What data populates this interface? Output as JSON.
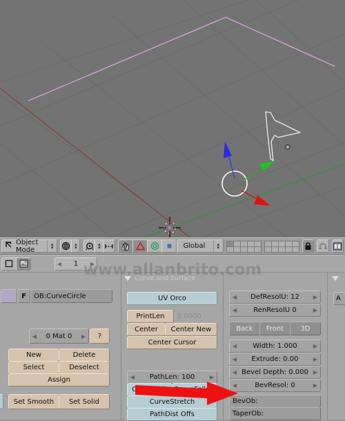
{
  "viewport": {
    "name": "3d-viewport",
    "background_color": "#737373",
    "grid_color": "#6a6a6a",
    "axis_x_color": "#8c3a3a",
    "axis_y_color": "#3a8c3a",
    "objects": [
      {
        "name": "curve-path-pink",
        "color": "#d9a6d9",
        "type": "path-curve"
      },
      {
        "name": "curve-shape-white",
        "color": "#e8e0ec",
        "type": "bezier-curve"
      },
      {
        "name": "curve-circle",
        "color": "#ffffff",
        "type": "circle"
      }
    ],
    "manipulator": {
      "x_axis_color": "#e01010",
      "y_axis_color": "#10c010",
      "z_axis_color": "#2020e0"
    },
    "cursor_3d": "3d-cursor"
  },
  "header": {
    "mode": "Object Mode",
    "transform_orientation": "Global",
    "icons": {
      "mode_icon": "object-mode-icon",
      "shading_icon": "shading-solid-icon",
      "pivot_icon": "pivot-median-icon",
      "snap_icon": "snap-icon",
      "manip_hand": "manipulator-translate-icon",
      "manip_rotate": "manipulator-rotate-icon",
      "manip_scale": "manipulator-scale-icon",
      "manip_square": "manipulator-square-icon",
      "lock_icon": "lock-icon",
      "magnet_icon": "magnet-icon",
      "render_icon": "render-window-icon"
    },
    "layers_lock": "lock-icon"
  },
  "second_bar": {
    "icons": {
      "buttons_window_icon": "buttons-window-icon",
      "image_icon": "image-browser-icon"
    },
    "frame": "1"
  },
  "watermark": "www.allanbrito.com",
  "panels": {
    "link_and_materials": {
      "object_field": {
        "prefix": "F",
        "value": "OB:CurveCircle"
      },
      "material_index": "0 Mat 0",
      "help_button": "?",
      "buttons": [
        "New",
        "Delete",
        "Select",
        "Deselect",
        "Assign"
      ],
      "shading": [
        "Set Smooth",
        "Set Solid"
      ]
    },
    "curve_and_surface": {
      "title": "Curve and Surface",
      "uv_orco": "UV Orco",
      "printlen": "PrintLen",
      "printlen_value": "0.0000",
      "center": "Center",
      "center_new": "Center New",
      "center_cursor": "Center Cursor",
      "pathlen": "PathLen: 100",
      "curvepath": "CurvePath",
      "curvefollow": "CurveFollow",
      "curvestretch": "CurveStretch",
      "pathdist_offs": "PathDist Offs"
    },
    "curve_tools": {
      "defresolu": "DefResolU: 12",
      "renresolu": "RenResolU 0",
      "back": "Back",
      "front": "Front",
      "threed": "3D",
      "width": "Width: 1.000",
      "extrude": "Extrude: 0.00",
      "bevel_depth": "Bevel Depth: 0.000",
      "bevresol": "BevResol: 0",
      "bevob_label": "BevOb:",
      "taperob_label": "TaperOb:"
    },
    "right_panel": {
      "first_button": "A"
    }
  },
  "annotation": {
    "arrow_color": "#ee1111",
    "arrow_name": "red-pointer-arrow",
    "points_to": "BevOb:"
  }
}
